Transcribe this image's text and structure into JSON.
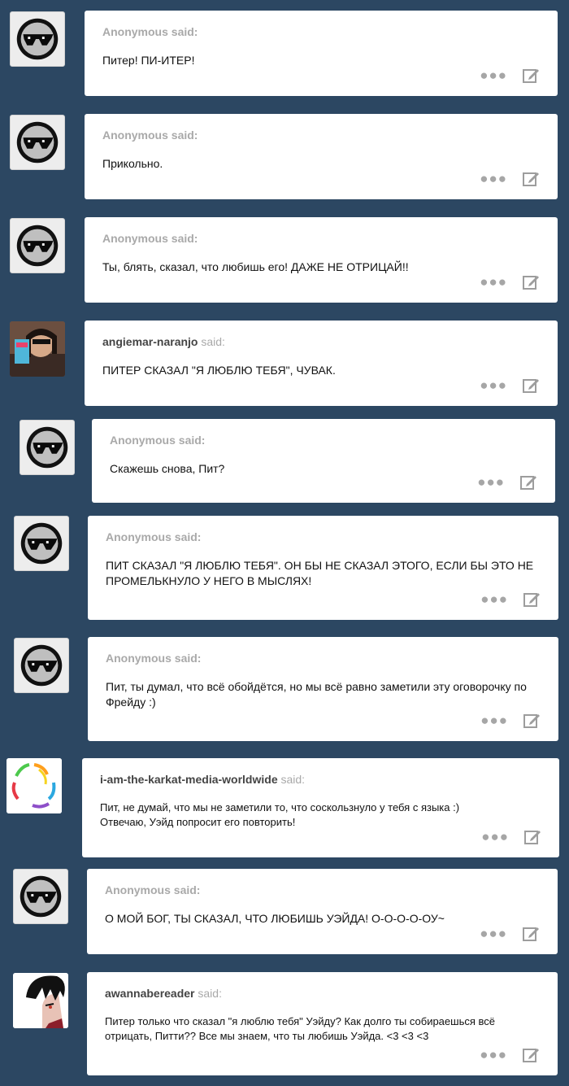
{
  "said_label": "said:",
  "controls": {
    "more_icon": "ellipsis-icon",
    "edit_icon": "edit-icon"
  },
  "posts": [
    {
      "asker": "Anonymous",
      "anonymous": true,
      "message": "Питер! ПИ-ИТЕР!"
    },
    {
      "asker": "Anonymous",
      "anonymous": true,
      "message": "Прикольно."
    },
    {
      "asker": "Anonymous",
      "anonymous": true,
      "message": "Ты, блять, сказал, что любишь его! ДАЖЕ НЕ ОТРИЦАЙ!!"
    },
    {
      "asker": "angiemar-naranjo",
      "anonymous": false,
      "message": "ПИТЕР СКАЗАЛ \"Я ЛЮБЛЮ ТЕБЯ\", ЧУВАК."
    },
    {
      "asker": "Anonymous",
      "anonymous": true,
      "message": "Скажешь снова, Пит?"
    },
    {
      "asker": "Anonymous",
      "anonymous": true,
      "message": "ПИТ СКАЗАЛ \"Я ЛЮБЛЮ ТЕБЯ\". ОН БЫ НЕ СКАЗАЛ ЭТОГО, ЕСЛИ БЫ ЭТО НЕ ПРОМЕЛЬКНУЛО У НЕГО В МЫСЛЯХ!"
    },
    {
      "asker": "Anonymous",
      "anonymous": true,
      "message": "Пит, ты думал, что всё обойдётся, но мы всё равно заметили эту оговорочку по Фрейду :)"
    },
    {
      "asker": "i-am-the-karkat-media-worldwide",
      "anonymous": false,
      "message": "Пит, не думай, что мы не заметили то, что соскользнуло у тебя с языка :)\nОтвечаю, Уэйд попросит его повторить!"
    },
    {
      "asker": "Anonymous",
      "anonymous": true,
      "message": "О МОЙ БОГ, ТЫ СКАЗАЛ, ЧТО ЛЮБИШЬ УЭЙДА! О-О-О-О-ОУ~"
    },
    {
      "asker": "awannabereader",
      "anonymous": false,
      "message": "Питер только что сказал \"я люблю тебя\" Уэйду? Как долго ты собираешься всё отрицать, Питти?? Все мы знаем, что ты любишь Уэйда. <3 <3 <3"
    }
  ]
}
